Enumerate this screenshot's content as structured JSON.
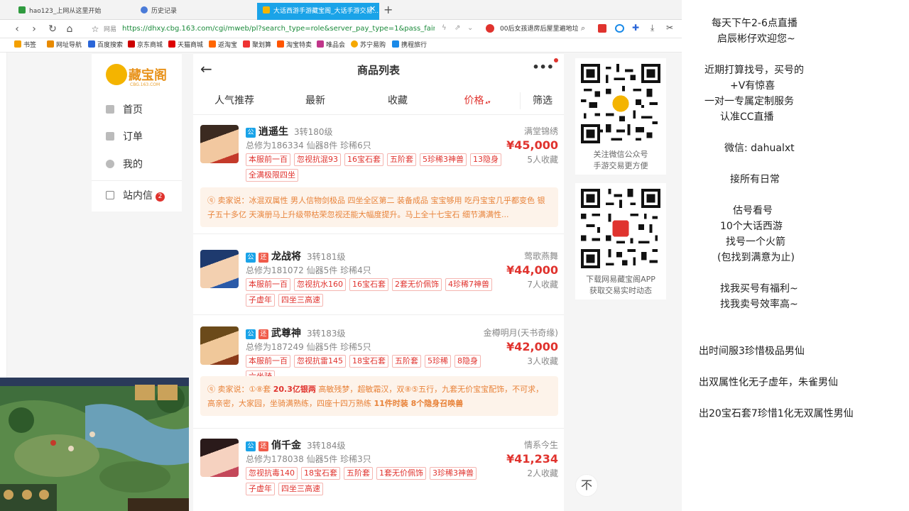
{
  "browser": {
    "tabs": [
      {
        "label": "hao123_上网从这里开始",
        "active": false,
        "icon_color": "#2f9b3f"
      },
      {
        "label": "历史记录",
        "active": false,
        "icon_color": "#4a7bd8"
      },
      {
        "label": "大话西游手游藏宝阁_大话手游交易...",
        "active": true,
        "icon_color": "#f4b400"
      }
    ],
    "new_tab_icon": "plus-icon",
    "site_label": "网易",
    "url": "https://dhxy.cbg.163.com/cgi/mweb/pl?search_type=role&server_pay_type=1&pass_fair_show",
    "search_text": "00后女孩退房后屋里遍地垃",
    "bookmarks": [
      "书签",
      "网址导航",
      "百度搜索",
      "京东商城",
      "天猫商城",
      "返淘宝",
      "聚划算",
      "淘宝特卖",
      "唯品会",
      "苏宁易购",
      "携程旅行"
    ]
  },
  "sidebar": {
    "logo_text": "藏宝阁",
    "logo_sub": "CBG.163.COM",
    "items": [
      {
        "label": "首页",
        "icon": "home-icon"
      },
      {
        "label": "订单",
        "icon": "order-icon"
      },
      {
        "label": "我的",
        "icon": "user-icon"
      },
      {
        "label": "站内信",
        "icon": "mail-icon",
        "badge": "2"
      }
    ]
  },
  "header": {
    "title": "商品列表",
    "more": "•••"
  },
  "tabs": [
    "人气推荐",
    "最新",
    "收藏",
    "价格",
    "筛选"
  ],
  "active_tab": "价格",
  "items": [
    {
      "name": "逍遥生",
      "badges": [
        "公"
      ],
      "level": "3转180级",
      "stats": "总修为186334  仙器8件  珍稀6只",
      "server": "满堂锦绣",
      "price": "¥45,000",
      "collect": "5人收藏",
      "tags": [
        "本服前一百",
        "忽视抗混93",
        "16宝石套",
        "五阶套",
        "5珍稀3神兽",
        "13隐身",
        "全满极限四坐"
      ],
      "say_label": "卖家说：",
      "say": "冰混双属性 男人信物剑极品 四坐全区第二 装备成品 宝宝够用 吃丹宝宝几乎都变色 银子五十多亿 天演册马上升级带枯荣忽视还能大幅度提升。马上全十七宝石 细节满满性..."
    },
    {
      "name": "龙战将",
      "badges": [
        "公",
        "还"
      ],
      "level": "3转181级",
      "stats": "总修为181072  仙器5件  珍稀4只",
      "server": "莺歌燕舞",
      "price": "¥44,000",
      "collect": "7人收藏",
      "tags": [
        "本服前一百",
        "忽视抗水160",
        "16宝石套",
        "2套无价佩饰",
        "4珍稀7神兽",
        "子虚年",
        "四坐三高速"
      ]
    },
    {
      "name": "武尊神",
      "badges": [
        "公",
        "还"
      ],
      "level": "3转183级",
      "stats": "总修为187249  仙器5件  珍稀5只",
      "server": "金樽明月(天书奇缘)",
      "price": "¥42,000",
      "collect": "3人收藏",
      "tags": [
        "本服前一百",
        "忽视抗雷145",
        "18宝石套",
        "五阶套",
        "5珍稀",
        "8隐身",
        "六坐骑"
      ],
      "say_label": "卖家说：",
      "say_pre": "①⑧套 ",
      "say_b1": "20.3亿银两",
      "say_mid": " 高敏残梦，超敏霜汉，双⑧⑤五行，九套无价宝宝配饰，不可求，高亲密，大家园，坐骑满熟练，四座十四万熟练 ",
      "say_b2": "11件时装 8个隐身召唤兽"
    },
    {
      "name": "俏千金",
      "badges": [
        "公",
        "还"
      ],
      "level": "3转184级",
      "stats": "总修为178038  仙器5件  珍稀3只",
      "server": "情系今生",
      "price": "¥41,234",
      "collect": "2人收藏",
      "tags": [
        "忽视抗毒140",
        "18宝石套",
        "五阶套",
        "1套无价佩饰",
        "3珍稀3神兽",
        "子虚年",
        "四坐三高速"
      ]
    }
  ],
  "qr": {
    "wechat_text": [
      "关注微信公众号",
      "手游交易更方便"
    ],
    "app_text": [
      "下载网易藏宝阁APP",
      "获取交易实时动态"
    ]
  },
  "totop": "不",
  "stream_panel": {
    "lines": [
      "每天下午2-6点直播",
      "启辰彬仔欢迎您~",
      "近期打算找号，买号的",
      "+V有惊喜",
      "一对一专属定制服务",
      "认准CC直播",
      "微信:    dahualxt",
      "接所有日常",
      "估号看号",
      "10个大话西游",
      "找号一个火箭",
      "(包找到满意为止)",
      "找我买号有福利~",
      "找我卖号效率高~",
      "出时间服3珍惜极品男仙",
      "出双属性化无子虚年，朱雀男仙",
      "出20宝石套7珍惜1化无双属性男仙"
    ]
  }
}
